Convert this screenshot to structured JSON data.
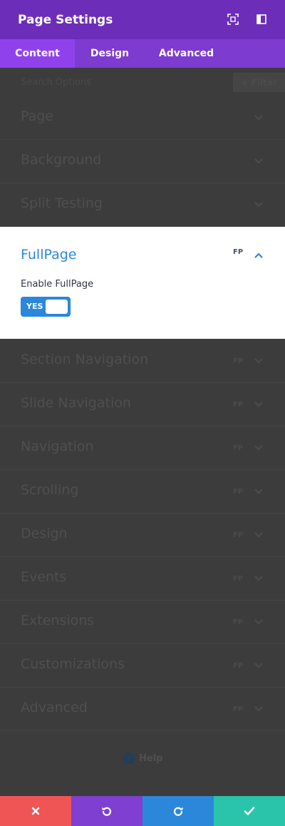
{
  "header": {
    "title": "Page Settings",
    "icons": [
      "expand-icon",
      "split-view-icon"
    ]
  },
  "tabs": [
    {
      "label": "Content",
      "active": true
    },
    {
      "label": "Design",
      "active": false
    },
    {
      "label": "Advanced",
      "active": false
    }
  ],
  "search": {
    "placeholder": "Search Options",
    "filter_label": "+ Filter"
  },
  "sections_top": [
    {
      "label": "Page"
    },
    {
      "label": "Background"
    },
    {
      "label": "Split Testing"
    }
  ],
  "fullpage": {
    "title": "FullPage",
    "badge": "FP",
    "toggle_label": "Enable FullPage",
    "toggle_value": "YES",
    "toggle_on": true
  },
  "sections_bottom": [
    {
      "label": "Section Navigation",
      "badge": "FP"
    },
    {
      "label": "Slide Navigation",
      "badge": "FP"
    },
    {
      "label": "Navigation",
      "badge": "FP"
    },
    {
      "label": "Scrolling",
      "badge": "FP"
    },
    {
      "label": "Design",
      "badge": "FP"
    },
    {
      "label": "Events",
      "badge": "FP"
    },
    {
      "label": "Extensions",
      "badge": "FP"
    },
    {
      "label": "Customizations",
      "badge": "FP"
    },
    {
      "label": "Advanced",
      "badge": "FP"
    }
  ],
  "help": {
    "label": "Help",
    "icon_glyph": "?"
  },
  "footer": {
    "buttons": [
      {
        "name": "discard",
        "icon": "close-icon",
        "color": "#ef5555"
      },
      {
        "name": "undo",
        "icon": "undo-icon",
        "color": "#7f3fd0"
      },
      {
        "name": "redo",
        "icon": "redo-icon",
        "color": "#2b87da"
      },
      {
        "name": "save",
        "icon": "check-icon",
        "color": "#29c4a9"
      }
    ]
  },
  "colors": {
    "header": "#6c2eb9",
    "tabs": "#7d3bcf",
    "tab_active": "#8f42ec",
    "accent": "#2b87da",
    "overlay": "#3c3c3c"
  }
}
